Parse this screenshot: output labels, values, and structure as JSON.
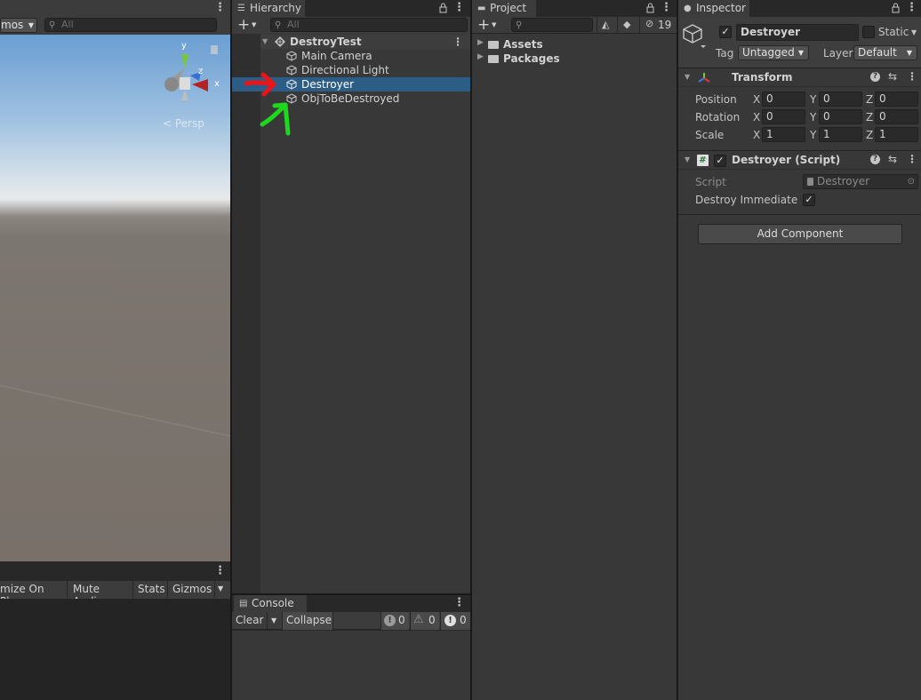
{
  "scene": {
    "toolbar_left_label": "mos",
    "search_placeholder": "All",
    "gizmo_axis_y": "y",
    "gizmo_axis_x": "x",
    "gizmo_axis_z": "z",
    "persp_label": "< Persp",
    "bottom_buttons": [
      "mize On Play",
      "Mute Audio",
      "Stats",
      "Gizmos"
    ]
  },
  "hierarchy": {
    "tab_label": "Hierarchy",
    "search_placeholder": "All",
    "scene_name": "DestroyTest",
    "items": [
      {
        "label": "Main Camera"
      },
      {
        "label": "Directional Light"
      },
      {
        "label": "Destroyer"
      },
      {
        "label": "ObjToBeDestroyed"
      }
    ]
  },
  "console": {
    "tab_label": "Console",
    "clear_label": "Clear",
    "collapse_label": "Collapse",
    "info_count": "0",
    "warn_count": "0",
    "error_count": "0"
  },
  "project": {
    "tab_label": "Project",
    "hidden_count": "19",
    "folders": [
      {
        "label": "Assets"
      },
      {
        "label": "Packages"
      }
    ]
  },
  "inspector": {
    "tab_label": "Inspector",
    "object_name": "Destroyer",
    "static_label": "Static",
    "tag_label": "Tag",
    "tag_value": "Untagged",
    "layer_label": "Layer",
    "layer_value": "Default",
    "transform": {
      "title": "Transform",
      "rows": [
        {
          "label": "Position",
          "x": "0",
          "y": "0",
          "z": "0"
        },
        {
          "label": "Rotation",
          "x": "0",
          "y": "0",
          "z": "0"
        },
        {
          "label": "Scale",
          "x": "1",
          "y": "1",
          "z": "1"
        }
      ],
      "axis_x": "X",
      "axis_y": "Y",
      "axis_z": "Z"
    },
    "script_component": {
      "title": "Destroyer (Script)",
      "script_label": "Script",
      "script_value": "Destroyer",
      "destroy_immediate_label": "Destroy Immediate",
      "destroy_immediate_checked": true
    },
    "add_component_label": "Add Component"
  },
  "colors": {
    "selection": "#2c5d87",
    "arrow_red": "#e8151b",
    "arrow_green": "#1ed81e"
  }
}
